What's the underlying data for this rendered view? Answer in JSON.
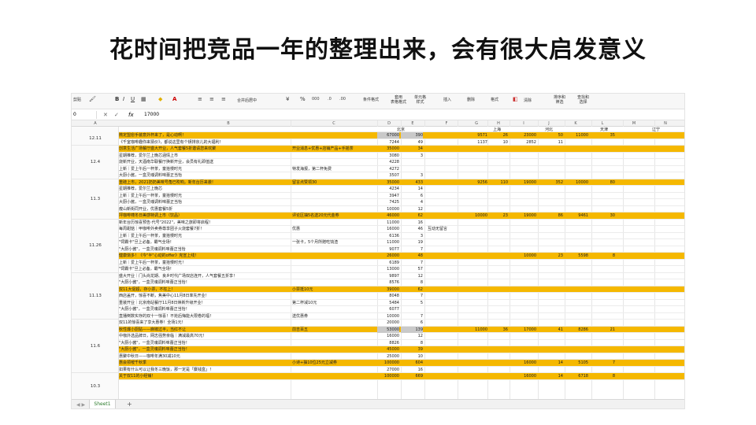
{
  "title": "花时间把竞品一年的整理出来，会有很大启发意义",
  "ribbon": {
    "left_cut": "剪贴",
    "bold": "B",
    "italic": "I",
    "underline": "U",
    "font_color": "A",
    "merge": "合并后居中",
    "percent": "%",
    "cond_format": "条件格式",
    "table_format": "套用\n表格格式",
    "cell_style": "单元格\n样式",
    "insert": "插入",
    "delete": "删除",
    "format": "格式",
    "clear": "清除",
    "sort_filter": "排序和\n筛选",
    "find_select": "查找和\n选择"
  },
  "formula_bar": {
    "name_box": "0",
    "fx": "fx",
    "value": "17000"
  },
  "columns": [
    "A",
    "B",
    "C",
    "D",
    "E",
    "F",
    "G",
    "H",
    "I",
    "J",
    "K",
    "L",
    "M",
    "N"
  ],
  "region_headers": {
    "beijing": "北京",
    "shanghai": "上海",
    "hebei": "河北",
    "tianjin": "天津",
    "liaoning": "辽宁"
  },
  "groups": [
    {
      "date": "12.11",
      "rows": 2
    },
    {
      "date": "12.4",
      "rows": 5
    },
    {
      "date": "11.3",
      "rows": 6
    },
    {
      "date": "11.26",
      "rows": 8
    },
    {
      "date": "11.13",
      "rows": 7
    },
    {
      "date": "11.6",
      "rows": 8
    },
    {
      "date": "10.3",
      "rows": 4
    },
    {
      "date": "10.12",
      "rows": 2
    },
    {
      "date": "10.9",
      "rows": 3
    }
  ],
  "rows": [
    {
      "hl": true,
      "b": "微定盟愈手装意外杯来了，是心动啊！",
      "c": "",
      "d": "67000",
      "e": "390",
      "grey": true,
      "g": "9571",
      "h": "26",
      "i": "23000",
      "j": "50",
      "k": "11000",
      "l": "35"
    },
    {
      "hl": false,
      "b": "《千室咖啡趣你来猜价》，都说这里有个钥排京儿的大福利！",
      "c": "",
      "d": "7244",
      "e": "49",
      "g": "1137",
      "h": "10",
      "i": "2852",
      "j": "11"
    },
    {
      "hl": true,
      "b": "创意生活广场餐厅盛大开业，人气套餐5折邀请您来欢聚",
      "c": "开业消息+优惠+店铺产品+手摇茶",
      "d": "35000",
      "e": "34"
    },
    {
      "hl": false,
      "b": "星期推荐，爱尔兰上晚芯涵情上市",
      "c": "",
      "d": "3080",
      "e": "3"
    },
    {
      "hl": false,
      "b": "烧新开业，天酒南华联餐厅换新开业，会员有礼即值送",
      "c": "",
      "d": "4228",
      "e": ""
    },
    {
      "hl": false,
      "b": "上新｜爱上午后一杯茶，童拾慢时光",
      "c": "特发海报，第二杯免费",
      "d": "4272",
      "e": ""
    },
    {
      "hl": false,
      "b": "大厨小酱，一盒灵魂调料味蕾正当怡",
      "c": "",
      "d": "3507",
      "e": "3"
    },
    {
      "hl": true,
      "b": "重磅上市，2021奶奶美味号角已吹响，新年台历来袭！",
      "c": "留言点赞领30",
      "d": "35000",
      "e": "433",
      "g": "9256",
      "h": "110",
      "i": "19000",
      "j": "352",
      "k": "10000",
      "l": "80"
    },
    {
      "hl": false,
      "b": "星期推荐，爱尔兰上晚芯",
      "c": "",
      "d": "4234",
      "e": "14"
    },
    {
      "hl": false,
      "b": "上新｜爱上午后一杯茶，童拾慢时光",
      "c": "",
      "d": "3947",
      "e": "6"
    },
    {
      "hl": false,
      "b": "大厨小酱，一盒灵魂调料味蕾正当怡",
      "c": "",
      "d": "7425",
      "e": "4"
    },
    {
      "hl": false,
      "b": "瘦山新街同开业，优惠套餐5折",
      "c": "",
      "d": "10000",
      "e": "12"
    },
    {
      "hl": true,
      "b": "坪咖啡啸冬日美感特调上市（饮品）",
      "c": "评论区抽5名送20元代金券",
      "d": "46000",
      "e": "62",
      "g": "10000",
      "h": "23",
      "i": "19000",
      "j": "86",
      "k": "9461",
      "l": "30"
    },
    {
      "hl": false,
      "b": "新年台历惊喜预告·代号\"2022\"，美味之旅即将启程！",
      "c": "",
      "d": "11000",
      "e": "16"
    },
    {
      "hl": false,
      "b": "每周甜惦｜甲咖啡外卖券尊享团子火烧套餐7折！",
      "c": "优惠",
      "d": "16000",
      "e": "46",
      "f": "互动无留言"
    },
    {
      "hl": false,
      "b": "上新｜爱上午后一杯茶，童拾慢时光",
      "c": "",
      "d": "6136",
      "e": "3"
    },
    {
      "hl": false,
      "b": "\"饲霸卡\"旦上必备，霸气全场！",
      "c": "一张卡，5个月所赠吃饷渣",
      "d": "11000",
      "e": "19"
    },
    {
      "hl": false,
      "b": "\"大厨小酱\"，一盒灵魂调料味蕾正当怡",
      "c": "",
      "d": "9077",
      "e": "7"
    },
    {
      "hl": true,
      "b": "健康渐多！《今\"半\"心动的offer》克宣上线！",
      "c": "",
      "d": "26000",
      "e": "48",
      "i": "10000",
      "j": "23",
      "k": "5598",
      "l": "8"
    },
    {
      "hl": false,
      "b": "上新｜爱上午后一杯茶，童拾慢时光！",
      "c": "",
      "d": "6189",
      "e": "7"
    },
    {
      "hl": false,
      "b": "\"饲霸卡\"旦上必备，霸气全场！",
      "c": "",
      "d": "13000",
      "e": "57"
    },
    {
      "hl": false,
      "b": "盛大开业｜门头尚龙期、良乡时代广场双店连开，人气套餐五折享！",
      "c": "",
      "d": "9897",
      "e": "12"
    },
    {
      "hl": false,
      "b": "\"大厨小酱\"，一盒灵魂调料味蕾正当怡！",
      "c": "",
      "d": "8576",
      "e": "8"
    },
    {
      "hl": true,
      "b": "双11大促超，存小票，不枉上！",
      "c": "小票抵10元",
      "d": "39000",
      "e": "62"
    },
    {
      "hl": false,
      "b": "西店盖开，惊喜不断，焦美中心11月8日率先开业！",
      "c": "",
      "d": "8048",
      "e": "7"
    },
    {
      "hl": false,
      "b": "重装开业｜北京南站餐厅11月8日焕新升级开业！",
      "c": "第二杯减10元",
      "d": "5484",
      "e": "5"
    },
    {
      "hl": false,
      "b": "\"大厨小酱\"，一盒灵魂调料味蕾正当怡！",
      "c": "",
      "d": "6077",
      "e": ""
    },
    {
      "hl": false,
      "b": "直播倒数实存的双十一惊喜！不抢后悔能大限卷的福！",
      "c": "送优惠券",
      "d": "10000",
      "e": "7"
    },
    {
      "hl": false,
      "b": "双11的惊喜来了享大惠券！全场1元！",
      "c": "",
      "d": "20000",
      "e": "6"
    },
    {
      "hl": true,
      "b": "秋性爆小厨贴——麻椒过半，当红不让",
      "c": "前吉百五",
      "d": "53000",
      "e": "139",
      "grey": true,
      "g": "11000",
      "h": "36",
      "i": "17000",
      "j": "41",
      "k": "8286",
      "l": "21"
    },
    {
      "hl": false,
      "b": "中咖外选品牌日，网志强势亲临｜满减最高70元！",
      "c": "",
      "d": "16000",
      "e": "12"
    },
    {
      "hl": false,
      "b": "\"大厨小酱\"，一盒灵魂调料味蕾正当怡！",
      "c": "",
      "d": "8826",
      "e": "8"
    },
    {
      "hl": true,
      "b": "\"大厨小酱\"，一盒灵魂调料味蕾正当怡！",
      "c": "",
      "d": "45000",
      "e": "39"
    },
    {
      "hl": false,
      "b": "惠聚中秋日——咖啡年满30减10元",
      "c": "",
      "d": "25000",
      "e": "10"
    },
    {
      "hl": true,
      "b": "惠会领嗳千秋季",
      "c": "小诗+抽10位25元立减券",
      "d": "100000",
      "e": "604",
      "i": "16000",
      "j": "14",
      "k": "5105",
      "l": "7"
    },
    {
      "hl": false,
      "b": "如果有什么可以让我冬三晚饭，那一定是「麋钱盒」！",
      "c": "",
      "d": "27000",
      "e": "16"
    },
    {
      "hl": true,
      "b": "关于双11的小经铺！",
      "c": "",
      "d": "100000",
      "e": "669",
      "i": "16000",
      "j": "14",
      "k": "6718",
      "l": "8"
    }
  ],
  "sheet_tab": "Sheet1",
  "add_tab": "+",
  "nav_arrows": "◀ ▶"
}
